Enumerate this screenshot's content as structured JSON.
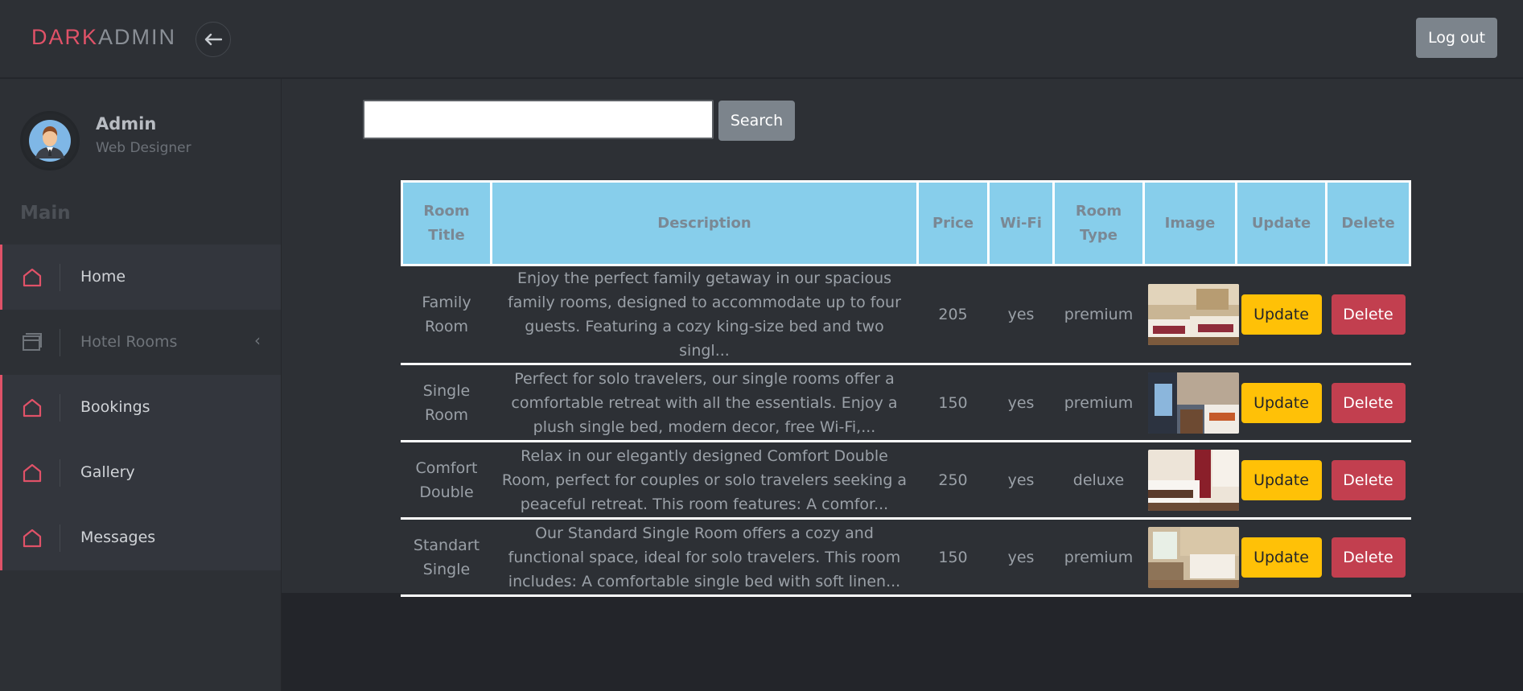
{
  "header": {
    "brand_part1": "DARK",
    "brand_part2": "ADMIN",
    "logout_label": "Log out",
    "toggle_icon": "arrow-left-icon"
  },
  "profile": {
    "name": "Admin",
    "role": "Web Designer"
  },
  "sidebar": {
    "section_label": "Main",
    "items": [
      {
        "label": "Home",
        "icon": "home-icon"
      },
      {
        "label": "Hotel Rooms",
        "icon": "window-icon"
      },
      {
        "label": "Bookings",
        "icon": "home-icon"
      },
      {
        "label": "Gallery",
        "icon": "home-icon"
      },
      {
        "label": "Messages",
        "icon": "home-icon"
      }
    ]
  },
  "search": {
    "value": "",
    "button_label": "Search"
  },
  "table": {
    "headers": [
      "Room Title",
      "Description",
      "Price",
      "Wi-Fi",
      "Room Type",
      "Image",
      "Update",
      "Delete"
    ],
    "rows": [
      {
        "title": "Family Room",
        "description": "Enjoy the perfect family getaway in our spacious family rooms, designed to accommodate up to four guests. Featuring a cozy king-size bed and two singl...",
        "price": "205",
        "wifi": "yes",
        "type": "premium",
        "update_label": "Update",
        "delete_label": "Delete"
      },
      {
        "title": "Single Room",
        "description": "Perfect for solo travelers, our single rooms offer a comfortable retreat with all the essentials. Enjoy a plush single bed, modern decor, free Wi-Fi,...",
        "price": "150",
        "wifi": "yes",
        "type": "premium",
        "update_label": "Update",
        "delete_label": "Delete"
      },
      {
        "title": "Comfort Double",
        "description": "Relax in our elegantly designed Comfort Double Room, perfect for couples or solo travelers seeking a peaceful retreat. This room features: A comfor...",
        "price": "250",
        "wifi": "yes",
        "type": "deluxe",
        "update_label": "Update",
        "delete_label": "Delete"
      },
      {
        "title": "Standart Single",
        "description": "Our Standard Single Room offers a cozy and functional space, ideal for solo travelers. This room includes: A comfortable single bed with soft linen...",
        "price": "150",
        "wifi": "yes",
        "type": "premium",
        "update_label": "Update",
        "delete_label": "Delete"
      }
    ]
  },
  "colors": {
    "accent": "#e05268",
    "header_bg": "#87ceeb",
    "update_btn": "#ffc107",
    "delete_btn": "#c23f4f",
    "panel_bg": "#2d3035"
  }
}
